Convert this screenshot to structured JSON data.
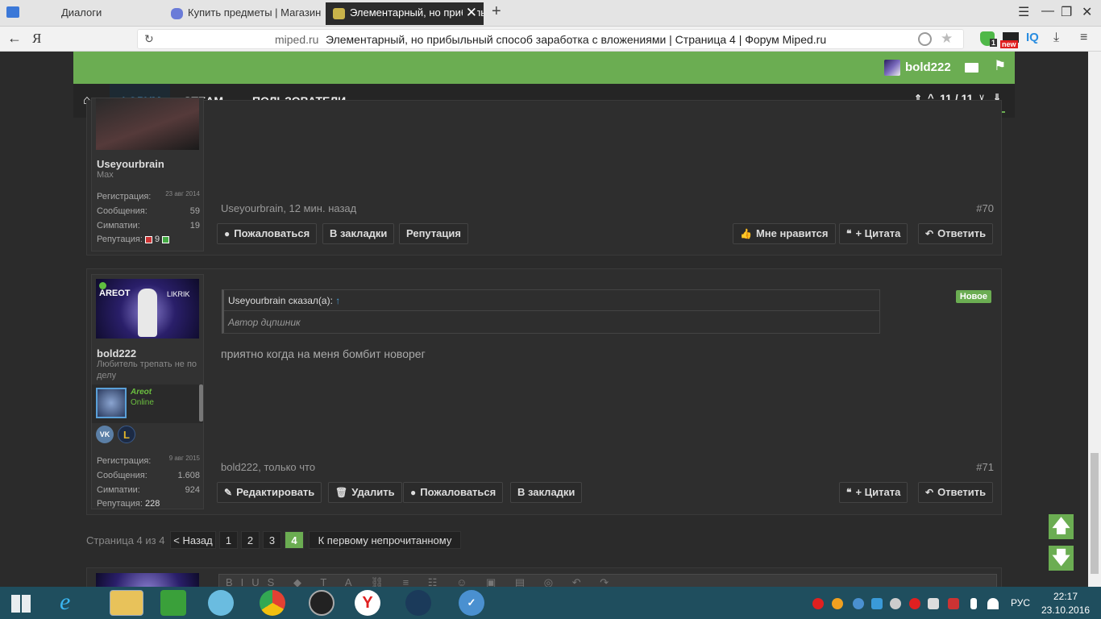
{
  "browser": {
    "tabs": [
      {
        "label": "Диалоги"
      },
      {
        "label": "Купить предметы | Магазин"
      },
      {
        "label": "Элементарный, но прибыльный"
      }
    ],
    "address_domain": "miped.ru",
    "address_title": "Элементарный, но прибыльный способ заработка с вложениями | Страница 4 | Форум Miped.ru",
    "ext_badge_count": "1",
    "ext_badge_new": "new",
    "iq_label": "IQ"
  },
  "header": {
    "username": "bold222"
  },
  "nav": {
    "forum": "ФОРУМ",
    "steam": "STEAM",
    "users": "ПОЛЬЗОВАТЕЛИ",
    "counter": "11 / 11"
  },
  "post70": {
    "author_name": "Useyourbrain",
    "author_title": "Max",
    "reg_label": "Регистрация:",
    "reg_value": "23 авг 2014",
    "msg_label": "Сообщения:",
    "msg_value": "59",
    "likes_label": "Симпатии:",
    "likes_value": "19",
    "rep_label": "Репутация:",
    "rep_value": "9",
    "meta": "Useyourbrain, 12 мин. назад",
    "number": "#70",
    "btn_report": "Пожаловаться",
    "btn_bookmark": "В закладки",
    "btn_rep": "Репутация",
    "btn_like": "Мне нравится",
    "btn_quote": "+ Цитата",
    "btn_reply": "Ответить"
  },
  "post71": {
    "avatar_text_left": "AREOT",
    "avatar_text_right": "LIKRIK",
    "author_name": "bold222",
    "author_title": "Любитель трепать не по делу",
    "steam_name": "Areot",
    "steam_status": "Online",
    "reg_label": "Регистрация:",
    "reg_value": "9 авг 2015",
    "msg_label": "Сообщения:",
    "msg_value": "1.608",
    "likes_label": "Симпатии:",
    "likes_value": "924",
    "rep_label": "Репутация:",
    "rep_value": "228",
    "new_badge": "Новое",
    "quote_header": "Useyourbrain сказал(а):",
    "quote_text": "Автор дцпшник",
    "message": "приятно когда на меня бомбит новорег",
    "meta": "bold222, только что",
    "number": "#71",
    "btn_edit": "Редактировать",
    "btn_delete": "Удалить",
    "btn_report": "Пожаловаться",
    "btn_bookmark": "В закладки",
    "btn_quote": "+ Цитата",
    "btn_reply": "Ответить"
  },
  "pagination": {
    "label": "Страница 4 из 4",
    "prev": "< Назад",
    "pages": [
      "1",
      "2",
      "3",
      "4"
    ],
    "first_unread": "К первому непрочитанному"
  },
  "taskbar": {
    "lang": "РУС",
    "time": "22:17",
    "date": "23.10.2016"
  },
  "colors": {
    "accent_green": "#6bad52",
    "nav_active": "#4a9fd8",
    "page_bg": "#2b2b2b"
  }
}
